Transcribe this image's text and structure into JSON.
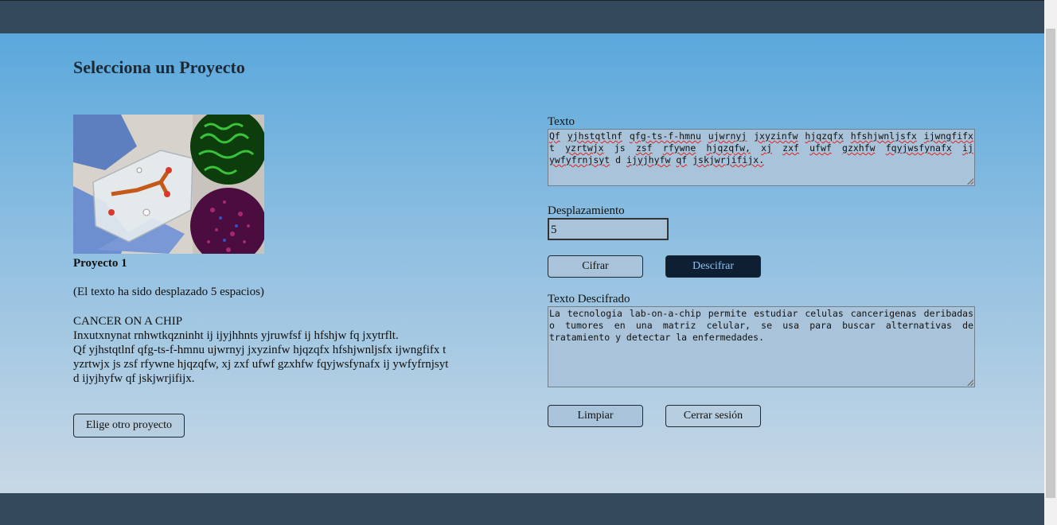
{
  "header": {
    "title": "Selecciona un Proyecto"
  },
  "project": {
    "title": "Proyecto 1",
    "note": "(El texto ha sido desplazado 5 espacios)",
    "body_lines": [
      "CANCER ON A CHIP",
      "Inxutxnynat rnhwtkqzninht ij ijyjhhnts yjruwfsf ij hfshjw fq jxytrflt.",
      "Qf yjhstqtlnf qfg-ts-f-hmnu ujwrnyj jxyzinfw hjqzqfx hfshjwnljsfx ijwngfifx t",
      "yzrtwjx js zsf rfywne hjqzqfw, xj zxf ufwf gzxhfw fqyjwsfynafx ij ywfyfrnjsyt",
      "d ijyjhyfw qf jskjwrjifijx."
    ],
    "other_button": "Elige otro proyecto",
    "image_icon": "lab-on-chip-photo"
  },
  "form": {
    "text_label": "Texto",
    "text_words": [
      "Qf",
      "yjhstqtlnf",
      "qfg-ts-f-hmnu",
      "ujwrnyj",
      "jxyzinfw",
      "hjqzqfx",
      "hfshjwnljsfx",
      "ijwngfifx",
      "t",
      "yzrtwjx",
      "js",
      "zsf",
      "rfywne",
      "hjqzqfw,",
      "xj",
      "zxf",
      "ufwf",
      "gzxhfw",
      "fqyjwsfynafx",
      "ij",
      "ywfyfrnjsyt",
      "d",
      "ijyjhyfw",
      "qf",
      "jskjwrjifijx."
    ],
    "shift_label": "Desplazamiento",
    "shift_value": "5",
    "encrypt_button": "Cifrar",
    "decrypt_button": "Descifrar",
    "result_label": "Texto Descifrado",
    "result_text": "La tecnologia lab-on-a-chip permite estudiar celulas cancerigenas deribadas o tumores en una matriz celular, se usa para buscar alternativas de tratamiento y detectar la enfermedades.",
    "clear_button": "Limpiar",
    "logout_button": "Cerrar sesión"
  },
  "colors": {
    "topbar": "#34495b",
    "accent_dark_button": "#0e1f33",
    "input_bg": "#a9c4da"
  }
}
